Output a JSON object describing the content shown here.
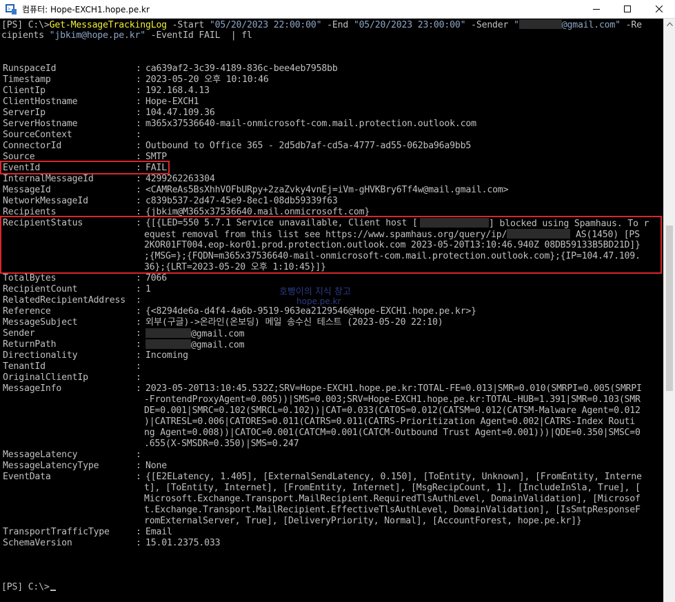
{
  "window": {
    "title": "컴퓨터: Hope-EXCH1.hope.pe.kr"
  },
  "command": {
    "prompt": "[PS] C:\\>",
    "cmdlet": "Get-MessageTrackingLog",
    "line1_rest_start": " -Start ",
    "start": "\"05/20/2023 22:00:00\"",
    "end_param": " -End ",
    "end": "\"05/20/2023 23:00:00\"",
    "sender_param": " -Sender ",
    "sender_q": "\"",
    "sender_tail": "@gmail.com\"",
    "recipients_param": " -Re",
    "line2_a": "cipients ",
    "recipients": "\"jbkim@hope.pe.kr\"",
    "line2_b": " -EventId FAIL  | fl"
  },
  "records": [
    {
      "key": "RunspaceId",
      "value": "ca639af2-3c39-4189-836c-bee4eb7958bb"
    },
    {
      "key": "Timestamp",
      "value": "2023-05-20 오후 10:10:46"
    },
    {
      "key": "ClientIp",
      "value": "192.168.4.13"
    },
    {
      "key": "ClientHostname",
      "value": "Hope-EXCH1"
    },
    {
      "key": "ServerIp",
      "value": "104.47.109.36"
    },
    {
      "key": "ServerHostname",
      "value": "m365x37536640-mail-onmicrosoft-com.mail.protection.outlook.com"
    },
    {
      "key": "SourceContext",
      "value": ""
    },
    {
      "key": "ConnectorId",
      "value": "Outbound to Office 365 - 2d5db7af-cd5a-4777-ad55-062ba96a9bb5"
    },
    {
      "key": "Source",
      "value": "SMTP"
    },
    {
      "key": "EventId",
      "value": "FAIL"
    },
    {
      "key": "InternalMessageId",
      "value": "4299262263304"
    },
    {
      "key": "MessageId",
      "value": "<CAMReAs5BsXhhVOFbURpy+2zaZvky4vnEj=iVm-gHVKBry6Tf4w@mail.gmail.com>"
    },
    {
      "key": "NetworkMessageId",
      "value": "c839b537-2d47-45e9-8ec1-08db59339f63"
    },
    {
      "key": "Recipients",
      "value": "{jbkim@M365x37536640.mail.onmicrosoft.com}"
    },
    {
      "key": "RecipientStatus",
      "value": "{[{LED=550 5.7.1 Service unavailable, Client host ["
    },
    {
      "key": "TotalBytes",
      "value": "7066"
    },
    {
      "key": "RecipientCount",
      "value": "1"
    },
    {
      "key": "RelatedRecipientAddress",
      "value": ""
    },
    {
      "key": "Reference",
      "value": "{<8294de6a-d4f4-4a6b-9519-963ea2129546@Hope-EXCH1.hope.pe.kr>}"
    },
    {
      "key": "MessageSubject",
      "value": "외부(구글)->온라인(온보딩) 메일 송수신 테스트 (2023-05-20 22:10)"
    },
    {
      "key": "Sender",
      "value": "@gmail.com"
    },
    {
      "key": "ReturnPath",
      "value": "@gmail.com"
    },
    {
      "key": "Directionality",
      "value": "Incoming"
    },
    {
      "key": "TenantId",
      "value": ""
    },
    {
      "key": "OriginalClientIp",
      "value": ""
    },
    {
      "key": "MessageInfo",
      "value": "2023-05-20T13:10:45.532Z;SRV=Hope-EXCH1.hope.pe.kr:TOTAL-FE=0.013|SMR=0.010(SMRPI=0.005(SMRPI"
    },
    {
      "key": "MessageLatency",
      "value": ""
    },
    {
      "key": "MessageLatencyType",
      "value": "None"
    },
    {
      "key": "EventData",
      "value": "{[E2ELatency, 1.405], [ExternalSendLatency, 0.150], [ToEntity, Unknown], [FromEntity, Interne"
    },
    {
      "key": "TransportTrafficType",
      "value": "Email"
    },
    {
      "key": "SchemaVersion",
      "value": "15.01.2375.033"
    }
  ],
  "recipient_status_cont": {
    "l1_tail": "] blocked using Spamhaus. To r",
    "l2_a": "equest removal from this list see https://www.spamhaus.org/query/ip/",
    "l2_b": " AS(1450) [PS",
    "l3": "2KOR01FT004.eop-kor01.prod.protection.outlook.com 2023-05-20T13:10:46.940Z 08DB59133B5BD21D]}",
    "l4": ";{MSG=};{FQDN=m365x37536640-mail-onmicrosoft-com.mail.protection.outlook.com};{IP=104.47.109.",
    "l5": "36};{LRT=2023-05-20 오후 1:10:45}]}"
  },
  "message_info_cont": [
    "-FrontendProxyAgent=0.005))|SMS=0.003;SRV=Hope-EXCH1.hope.pe.kr:TOTAL-HUB=1.391|SMR=0.103(SMR",
    "DE=0.001|SMRC=0.102(SMRCL=0.102))|CAT=0.033(CATOS=0.012(CATSM=0.012(CATSM-Malware Agent=0.012",
    ")|CATRESL=0.006|CATORES=0.011(CATRS=0.011(CATRS-Prioritization Agent=0.002|CATRS-Index Routi",
    "ng Agent=0.008))|CATOC=0.001(CATCM=0.001(CATCM-Outbound Trust Agent=0.001)))|QDE=0.350|SMSC=0",
    ".655(X-SMSDR=0.350)|SMS=0.247"
  ],
  "event_data_cont": [
    "t], [ToEntity, Internet], [FromEntity, Internet], [MsgRecipCount, 1], [IncludeInSla, True], [",
    "Microsoft.Exchange.Transport.MailRecipient.RequiredTlsAuthLevel, DomainValidation], [Microsof",
    "t.Exchange.Transport.MailRecipient.EffectiveTlsAuthLevel, DomainValidation], [IsSmtpResponseF",
    "romExternalServer, True], [DeliveryPriority, Normal], [AccountForest, hope.pe.kr]}"
  ],
  "final_prompt": "[PS] C:\\>",
  "watermark": {
    "line1": "호빵이의 지식 창고",
    "line2": "hope.pe.kr"
  },
  "colors": {
    "console_bg": "#000000",
    "console_text": "#c0c0c0",
    "cmdlet": "#f0f03a",
    "string": "#8ea6c6",
    "highlight_box": "#d9262c"
  }
}
